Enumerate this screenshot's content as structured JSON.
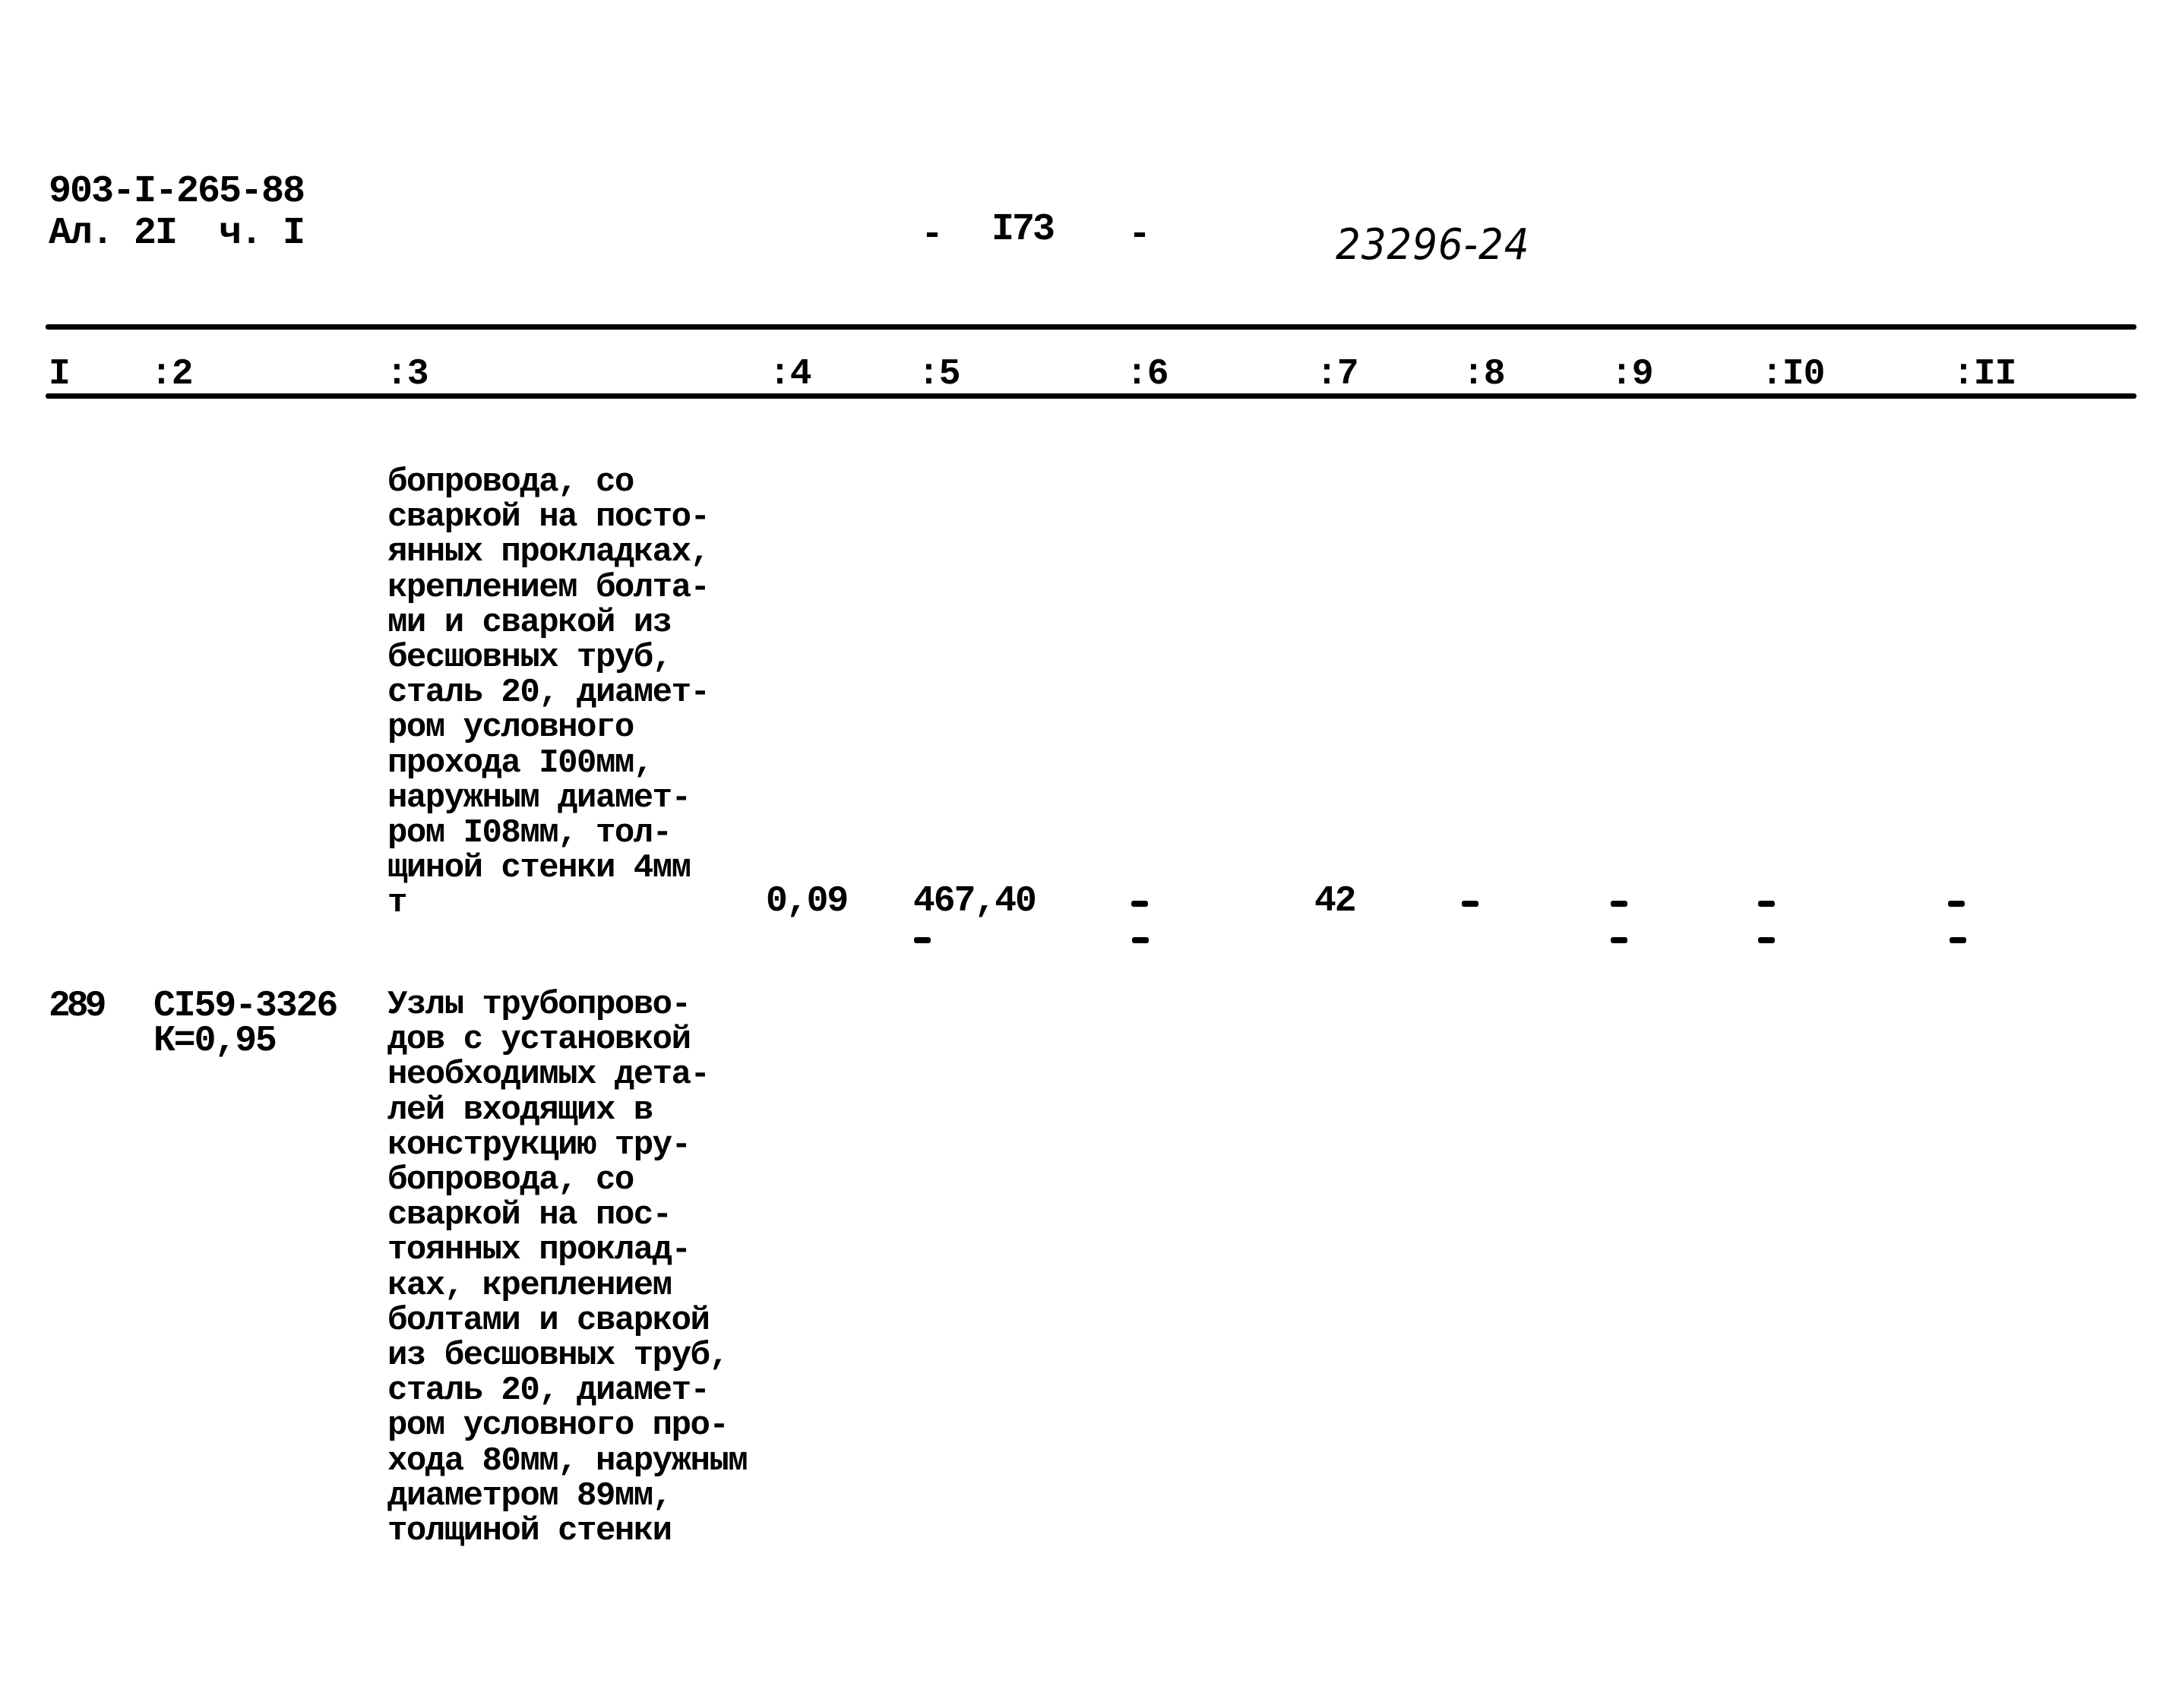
{
  "header": {
    "doc_code": "903-I-265-88",
    "album_line": "Ал. 2I  ч. I",
    "page_number": "I73",
    "page_dash_left": "-",
    "page_dash_right": "-",
    "handwritten_number": "23296-24"
  },
  "table": {
    "columns": [
      "I",
      ":2",
      ":3",
      ":4",
      ":5",
      ":6",
      ":7",
      ":8",
      ":9",
      ":I0",
      ":II"
    ],
    "rows": [
      {
        "num": "",
        "code": "",
        "code_coef": "",
        "description_lines": [
          "бопровода, со",
          "сваркой на посто-",
          "янных прокладках,",
          "креплением болта-",
          "ми и сваркой из",
          "бесшовных труб,",
          "сталь 20, диамет-",
          "ром условного",
          "прохода I00мм,",
          "наружным диамет-",
          "ром I08мм, тол-",
          "щиной стенки 4мм",
          "т"
        ],
        "col4": "0,09",
        "col5": "467,40",
        "col6": "-",
        "col7": "42",
        "col8": "-",
        "col9": "-",
        "col10": "-",
        "col11": "-",
        "sub": {
          "col5": "-",
          "col6": "-",
          "col9": "-",
          "col10": "-",
          "col11": "-"
        }
      },
      {
        "num": "289",
        "code": "CI59-3326",
        "code_coef": "К=0,95",
        "description_lines": [
          "Узлы трубопрово-",
          "дов с установкой",
          "необходимых дета-",
          "лей входящих в",
          "конструкцию тру-",
          "бопровода, со",
          "сваркой на пос-",
          "тоянных проклад-",
          "ках, креплением",
          "болтами и сваркой",
          "из бесшовных труб,",
          "сталь 20, диамет-",
          "ром условного про-",
          "хода 80мм, наружным",
          "диаметром 89мм,",
          "толщиной стенки"
        ]
      }
    ]
  }
}
